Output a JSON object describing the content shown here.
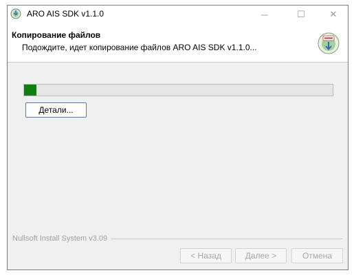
{
  "window": {
    "title": "ARO AIS SDK v1.1.0",
    "icon": "installer-disc-icon",
    "controls": {
      "minimize": "─",
      "maximize": "☐",
      "close": "✕"
    }
  },
  "header": {
    "title": "Копирование файлов",
    "subtitle": "Подождите, идет копирование файлов ARO AIS SDK v1.1.0...",
    "icon": "install-badge-icon"
  },
  "progress": {
    "value_percent": 4,
    "color": "#0f7f12"
  },
  "buttons": {
    "details": "Детали...",
    "back": "< Назад",
    "next": "Далее >",
    "cancel": "Отмена"
  },
  "footer": {
    "branding": "Nullsoft Install System v3.09"
  }
}
